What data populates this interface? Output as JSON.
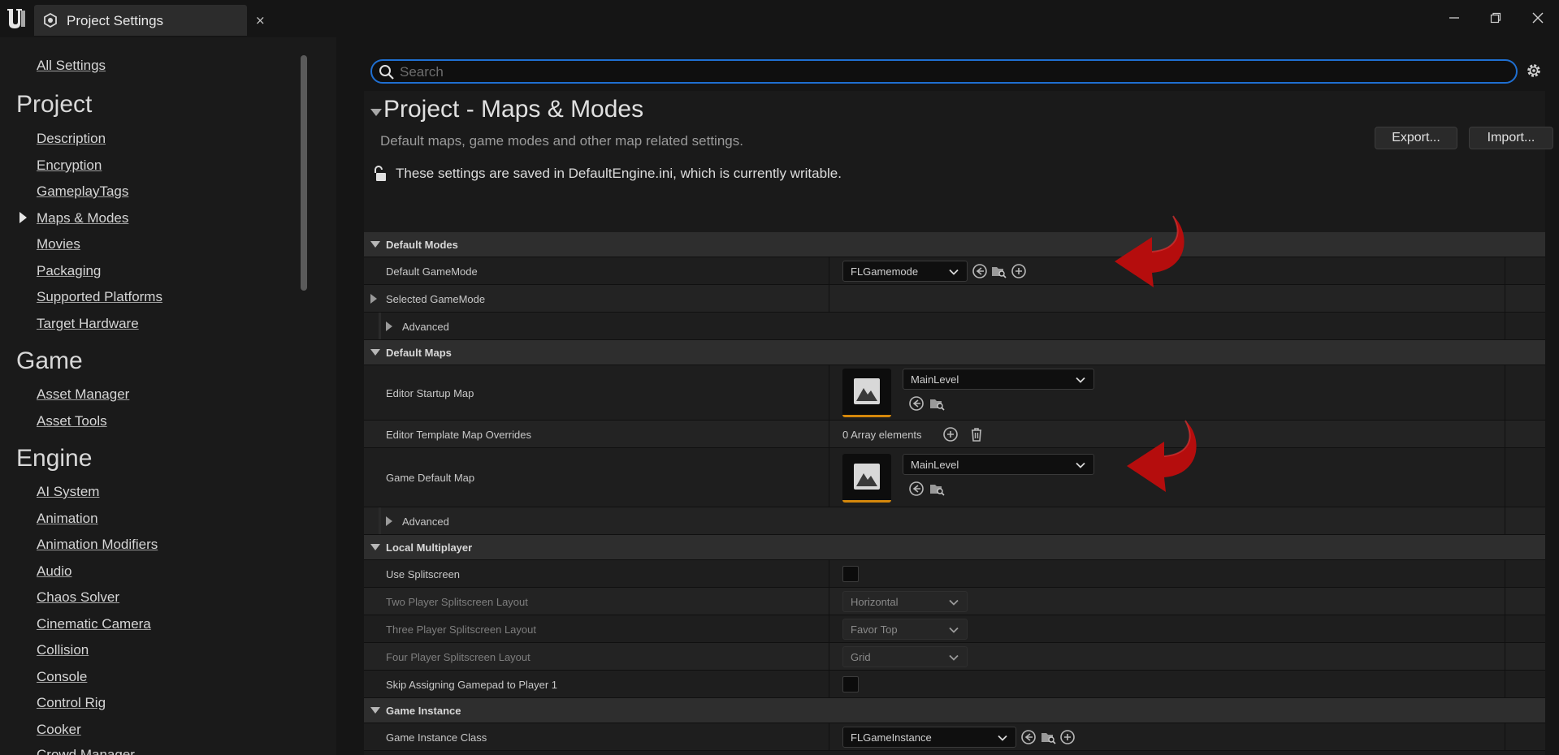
{
  "window": {
    "tab_title": "Project Settings",
    "close_glyph": "×"
  },
  "sidebar": {
    "all_settings": "All Settings",
    "sections": [
      {
        "heading": "Project",
        "items": [
          "Description",
          "Encryption",
          "GameplayTags",
          "Maps & Modes",
          "Movies",
          "Packaging",
          "Supported Platforms",
          "Target Hardware"
        ]
      },
      {
        "heading": "Game",
        "items": [
          "Asset Manager",
          "Asset Tools"
        ]
      },
      {
        "heading": "Engine",
        "items": [
          "AI System",
          "Animation",
          "Animation Modifiers",
          "Audio",
          "Chaos Solver",
          "Cinematic Camera",
          "Collision",
          "Console",
          "Control Rig",
          "Cooker",
          "Crowd Manager"
        ]
      }
    ],
    "active_item": "Maps & Modes"
  },
  "search": {
    "placeholder": "Search",
    "value": ""
  },
  "header": {
    "title": "Project - Maps & Modes",
    "subtitle": "Default maps, game modes and other map related settings.",
    "export_label": "Export...",
    "import_label": "Import...",
    "writable_note": "These settings are saved in DefaultEngine.ini, which is currently writable."
  },
  "categories": {
    "default_modes": "Default Modes",
    "default_maps": "Default Maps",
    "local_multiplayer": "Local Multiplayer",
    "game_instance": "Game Instance"
  },
  "props": {
    "default_gamemode": {
      "label": "Default GameMode",
      "value": "FLGamemode"
    },
    "selected_gamemode": {
      "label": "Selected GameMode"
    },
    "advanced_1": {
      "label": "Advanced"
    },
    "editor_startup_map": {
      "label": "Editor Startup Map",
      "value": "MainLevel"
    },
    "editor_template_overrides": {
      "label": "Editor Template Map Overrides",
      "value": "0 Array elements"
    },
    "game_default_map": {
      "label": "Game Default Map",
      "value": "MainLevel"
    },
    "advanced_2": {
      "label": "Advanced"
    },
    "use_splitscreen": {
      "label": "Use Splitscreen"
    },
    "two_player_layout": {
      "label": "Two Player Splitscreen Layout",
      "value": "Horizontal"
    },
    "three_player_layout": {
      "label": "Three Player Splitscreen Layout",
      "value": "Favor Top"
    },
    "four_player_layout": {
      "label": "Four Player Splitscreen Layout",
      "value": "Grid"
    },
    "skip_gamepad": {
      "label": "Skip Assigning Gamepad to Player 1"
    },
    "game_instance_class": {
      "label": "Game Instance Class",
      "value": "FLGameInstance"
    }
  },
  "colors": {
    "accent_blue": "#1f6fd1",
    "thumbnail_underline": "#d4870b",
    "annotation_arrow": "#b50d0d"
  }
}
